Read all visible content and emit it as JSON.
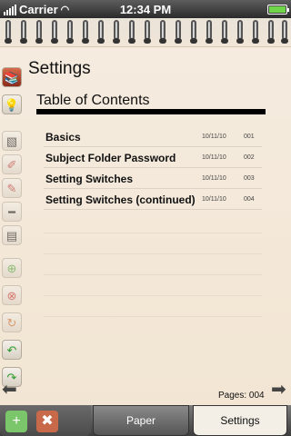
{
  "status_bar": {
    "carrier": "Carrier",
    "time": "12:34 PM"
  },
  "page": {
    "title": "Settings",
    "toc_heading": "Table of Contents",
    "rows": [
      {
        "title": "Basics",
        "date": "10/11/10",
        "page": "001"
      },
      {
        "title": "Subject Folder Password",
        "date": "10/11/10",
        "page": "002"
      },
      {
        "title": "Setting Switches",
        "date": "10/11/10",
        "page": "003"
      },
      {
        "title": "Setting Switches (continued)",
        "date": "10/11/10",
        "page": "004"
      }
    ],
    "pages_label": "Pages: 004"
  },
  "tabs": {
    "paper": "Paper",
    "settings": "Settings"
  },
  "icons": {
    "toolbar": [
      "notebooks-icon",
      "lightbulb-icon",
      "eraser-icon",
      "handwriting-icon",
      "pen-icon",
      "highlighter-icon",
      "clip-icon",
      "add-icon",
      "delete-icon",
      "copy-icon",
      "undo-icon",
      "redo-icon"
    ],
    "nav": [
      "prev-page-icon",
      "next-page-icon"
    ],
    "bottom": [
      "add-notebook-icon",
      "delete-notebook-icon"
    ]
  }
}
